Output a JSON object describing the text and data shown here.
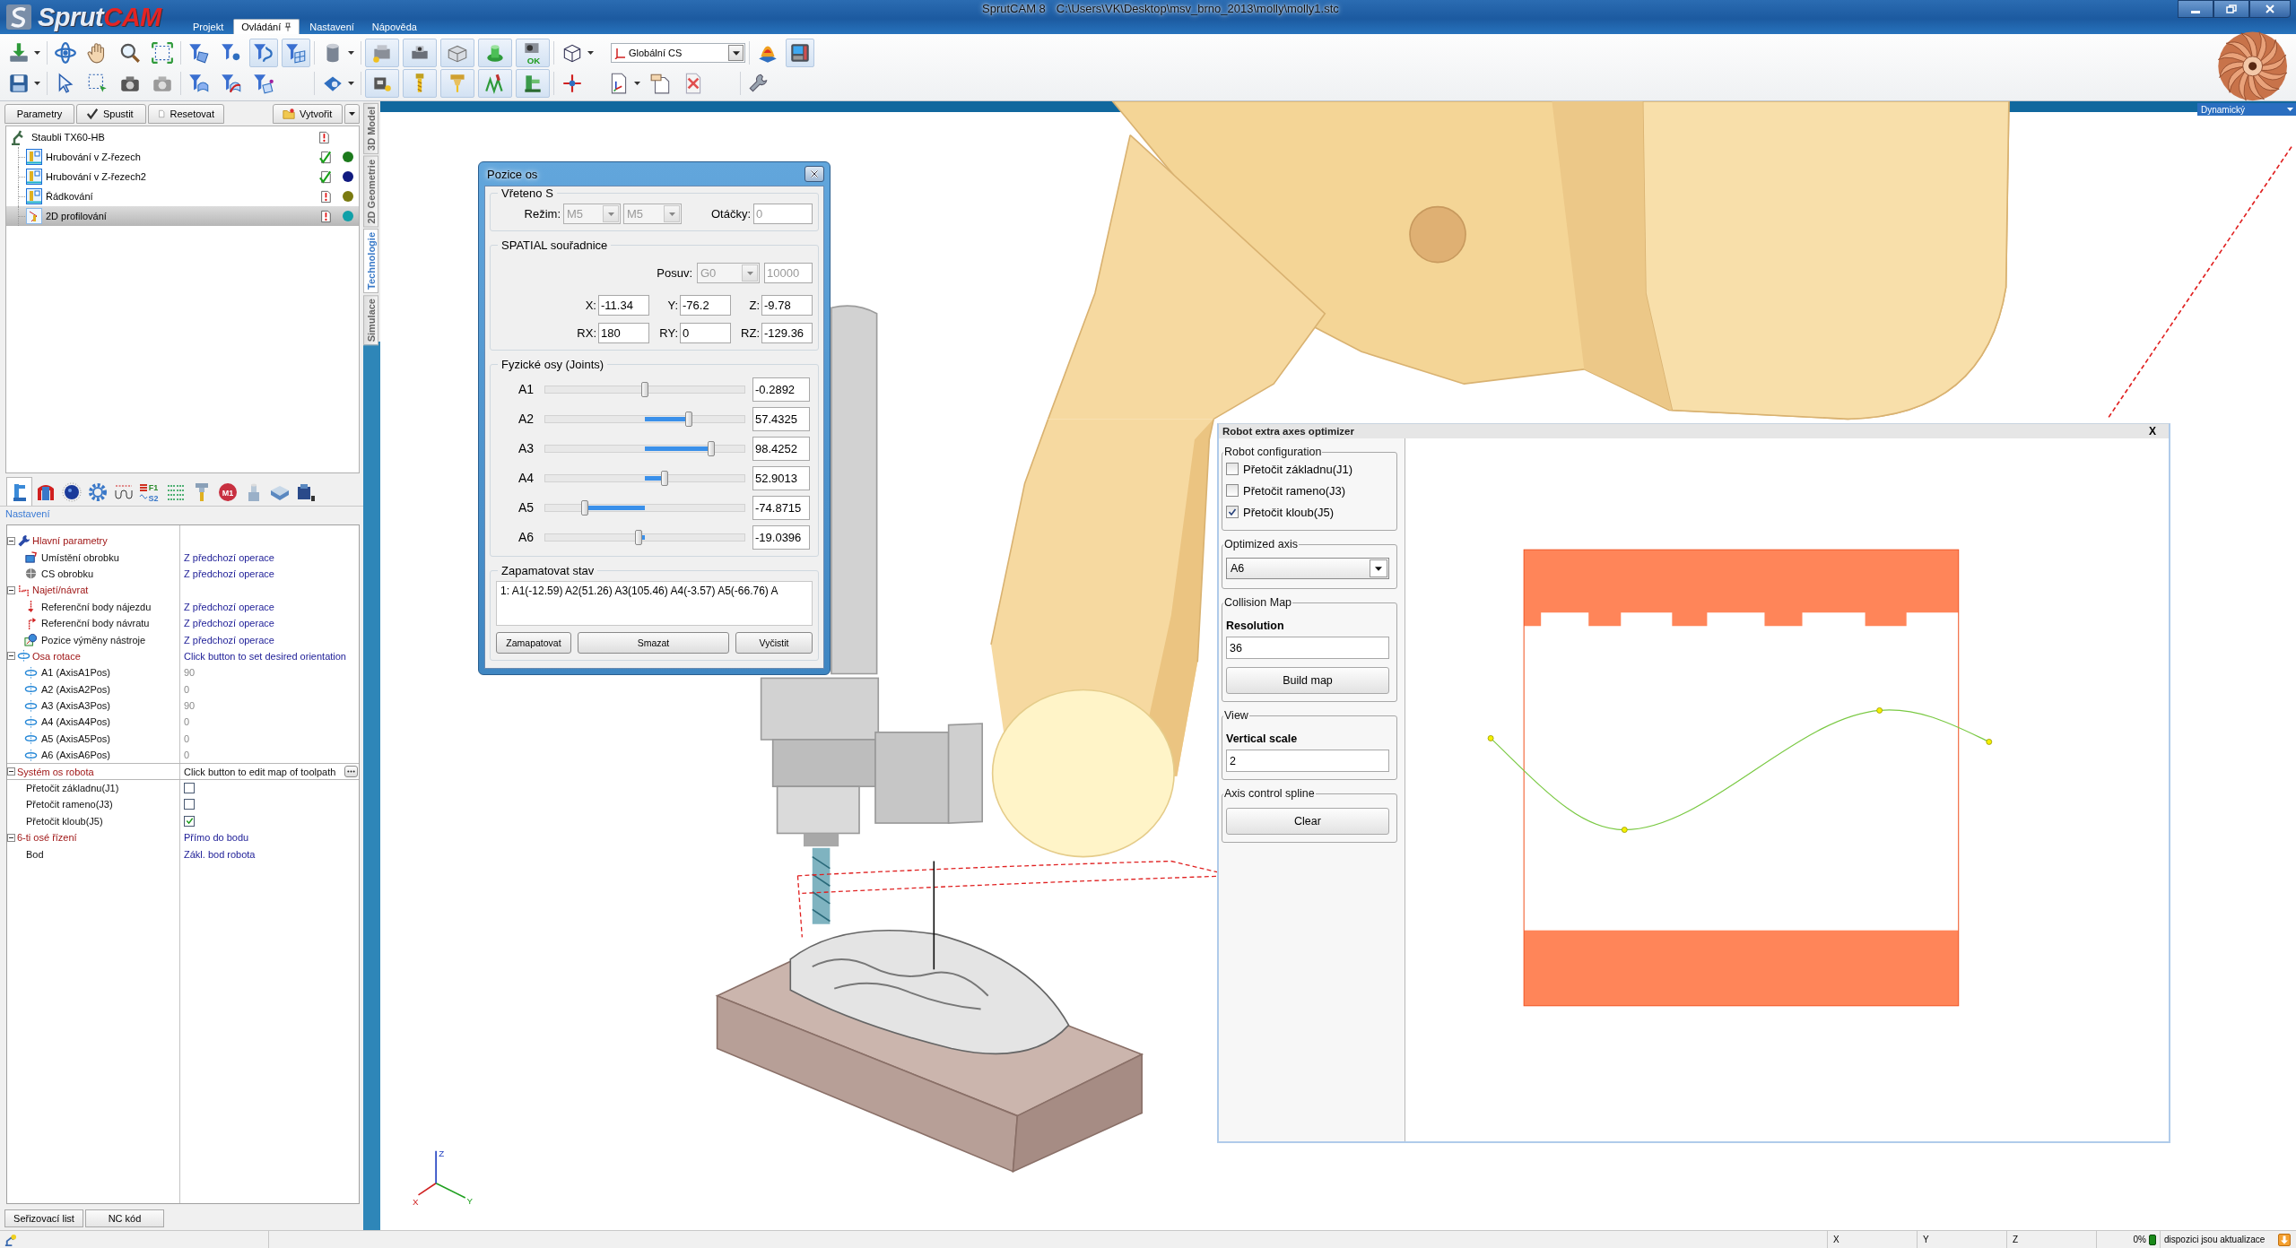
{
  "window": {
    "logo_text": "Sprut",
    "logo_accent": "CAM",
    "app_name": "SprutCAM 8",
    "file_path": "C:\\Users\\VK\\Desktop\\msv_brno_2013\\molly\\molly1.stc"
  },
  "ribbon_tabs": [
    {
      "label": "Projekt",
      "selected": false,
      "pinned": false
    },
    {
      "label": "Ovládání",
      "selected": true,
      "pinned": true
    },
    {
      "label": "Nastavení",
      "selected": false,
      "pinned": false
    },
    {
      "label": "Nápověda",
      "selected": false,
      "pinned": false
    }
  ],
  "toolbar": {
    "row_1": [
      {
        "pressed": false,
        "menu": true
      },
      {
        "pressed": false,
        "menu": false
      },
      {
        "pressed": false,
        "menu": false
      },
      {
        "pressed": false,
        "menu": false
      },
      {
        "pressed": false,
        "menu": false
      },
      {
        "pressed": false,
        "menu": false
      },
      {
        "pressed": false,
        "menu": false
      },
      {
        "pressed": true,
        "menu": false
      },
      {
        "pressed": true,
        "menu": false
      },
      {
        "pressed": false,
        "menu": true
      },
      {
        "pressed": true,
        "menu": false
      },
      {
        "pressed": true,
        "menu": false
      },
      {
        "pressed": true,
        "menu": false
      },
      {
        "pressed": true,
        "menu": false
      },
      {
        "pressed": true,
        "menu": false,
        "badge": "OK"
      },
      {
        "pressed": false,
        "menu": true
      },
      {
        "pressed": false,
        "menu": false
      },
      {
        "pressed": true,
        "menu": false
      }
    ],
    "cs_combo": "Globální CS",
    "row_2": [
      {
        "pressed": false,
        "menu": true
      },
      {
        "pressed": false,
        "menu": false
      },
      {
        "pressed": false,
        "menu": false
      },
      {
        "pressed": false,
        "menu": false
      },
      {
        "pressed": false,
        "menu": false
      },
      {
        "pressed": false,
        "menu": false
      },
      {
        "pressed": false,
        "menu": false
      },
      {
        "pressed": false,
        "menu": false
      },
      {
        "pressed": false,
        "menu": true
      },
      {
        "pressed": true,
        "menu": false
      },
      {
        "pressed": true,
        "menu": false
      },
      {
        "pressed": true,
        "menu": false
      },
      {
        "pressed": true,
        "menu": false
      },
      {
        "pressed": true,
        "menu": false
      },
      {
        "pressed": false,
        "menu": false
      },
      {
        "pressed": false,
        "menu": true
      },
      {
        "pressed": false,
        "menu": false
      },
      {
        "pressed": false,
        "menu": false
      },
      {
        "pressed": false,
        "menu": false
      }
    ]
  },
  "view_mode": "Dynamický",
  "left_panel": {
    "actions": [
      "Parametry",
      "Spustit",
      "Resetovat",
      "Vytvořit"
    ],
    "tree": {
      "label": "Staubli TX60-HB",
      "calculated": false,
      "selected": false,
      "children": [
        {
          "label": "Hrubování v Z-řezech",
          "calculated": true,
          "color": "#1c7a1c",
          "selected": false
        },
        {
          "label": "Hrubování v Z-řezech2",
          "calculated": true,
          "color": "#101a80",
          "selected": false
        },
        {
          "label": "Řádkování",
          "calculated": false,
          "color": "#7a7a10",
          "selected": false
        },
        {
          "label": "2D profilování",
          "calculated": false,
          "color": "#10a0a8",
          "selected": true
        }
      ]
    },
    "icon_tabs": [
      {
        "selected": true
      },
      {
        "selected": false
      },
      {
        "selected": false
      },
      {
        "selected": false
      },
      {
        "selected": false
      },
      {
        "selected": false,
        "labels": [
          "F1",
          "S2"
        ]
      },
      {
        "selected": false
      },
      {
        "selected": false
      },
      {
        "selected": false,
        "labels": [
          "M1"
        ]
      },
      {
        "selected": false
      },
      {
        "selected": false
      },
      {
        "selected": false
      }
    ],
    "section_title": "Nastavení",
    "properties": [
      {
        "kind": "group",
        "label": "Hlavní parametry",
        "expanded": true,
        "editor": false,
        "children": [
          {
            "kind": "option",
            "label": "Umístění obrobku",
            "value": "Z předchozí operace"
          },
          {
            "kind": "option",
            "label": "CS obrobku",
            "value": "Z předchozí operace"
          }
        ]
      },
      {
        "kind": "group",
        "label": "Najetí/návrat",
        "expanded": true,
        "editor": false,
        "children": [
          {
            "kind": "option",
            "label": "Referenční body nájezdu",
            "value": "Z předchozí operace"
          },
          {
            "kind": "option",
            "label": "Referenční body návratu",
            "value": "Z předchozí operace"
          },
          {
            "kind": "option",
            "label": "Pozice výměny nástroje",
            "value": "Z předchozí operace"
          }
        ]
      },
      {
        "kind": "group",
        "label": "Osa rotace",
        "value": "Click button to set desired orientation",
        "expanded": true,
        "editor": false,
        "children": [
          {
            "kind": "axis",
            "label": "A1 (AxisA1Pos)",
            "value": "90"
          },
          {
            "kind": "axis",
            "label": "A2 (AxisA2Pos)",
            "value": "0"
          },
          {
            "kind": "axis",
            "label": "A3 (AxisA3Pos)",
            "value": "90"
          },
          {
            "kind": "axis",
            "label": "A4 (AxisA4Pos)",
            "value": "0"
          },
          {
            "kind": "axis",
            "label": "A5 (AxisA5Pos)",
            "value": "0"
          },
          {
            "kind": "axis",
            "label": "A6 (AxisA6Pos)",
            "value": "0"
          }
        ]
      },
      {
        "kind": "group",
        "label": "Systém os robota",
        "value": "Click button to edit map of toolpath",
        "expanded": true,
        "editor": true,
        "children": [
          {
            "kind": "check",
            "label": "Přetočit základnu(J1)",
            "checked": false
          },
          {
            "kind": "check",
            "label": "Přetočit rameno(J3)",
            "checked": false
          },
          {
            "kind": "check",
            "label": "Přetočit kloub(J5)",
            "checked": true
          }
        ]
      },
      {
        "kind": "group",
        "label": "6-ti osé řízení",
        "value": "Přímo do bodu",
        "expanded": true,
        "editor": false,
        "children": [
          {
            "kind": "option",
            "label": "Bod",
            "value": "Zákl. bod robota"
          }
        ]
      }
    ],
    "bottom_tabs": [
      {
        "label": "Seřizovací list",
        "selected": false
      },
      {
        "label": "NC kód",
        "selected": false
      }
    ]
  },
  "side_tabs": [
    {
      "label": "3D Model",
      "selected": false
    },
    {
      "label": "2D Geometrie",
      "selected": false
    },
    {
      "label": "Technologie",
      "selected": true
    },
    {
      "label": "Simulace",
      "selected": false
    }
  ],
  "viewport": {
    "axis_labels": [
      "X",
      "Y",
      "Z"
    ]
  },
  "axis_dialog": {
    "title": "Pozice os",
    "spindle": {
      "title": "Vřeteno S",
      "mode_label": "Režim:",
      "modes": [
        {
          "value": "M5",
          "disabled": true
        },
        {
          "value": "M5",
          "disabled": true
        }
      ],
      "speed_label": "Otáčky:",
      "speed": {
        "value": "0",
        "disabled": true
      }
    },
    "spatial": {
      "title": "SPATIAL souřadnice",
      "feed_label": "Posuv:",
      "feed_mode": {
        "value": "G0",
        "disabled": true
      },
      "feed": {
        "value": "10000",
        "disabled": true
      },
      "coords": [
        {
          "label": "X:",
          "value": "-11.34"
        },
        {
          "label": "Y:",
          "value": "-76.2"
        },
        {
          "label": "Z:",
          "value": "-9.78"
        },
        {
          "label": "RX:",
          "value": "180"
        },
        {
          "label": "RY:",
          "value": "0"
        },
        {
          "label": "RZ:",
          "value": "-129.36"
        }
      ]
    },
    "joints": {
      "title": "Fyzické osy (Joints)",
      "axes": [
        {
          "name": "A1",
          "level": 0.502,
          "reading": "-0.2892"
        },
        {
          "name": "A2",
          "level": 0.72,
          "reading": "57.4325"
        },
        {
          "name": "A3",
          "level": 0.835,
          "reading": "98.4252"
        },
        {
          "name": "A4",
          "level": 0.6,
          "reading": "52.9013"
        },
        {
          "name": "A5",
          "level": 0.2,
          "reading": "-74.8715"
        },
        {
          "name": "A6",
          "level": 0.467,
          "reading": "-19.0396"
        }
      ]
    },
    "memory": {
      "title": "Zapamatovat stav",
      "entries": [
        "1: A1(-12.59) A2(51.26) A3(105.46) A4(-3.57) A5(-66.76) A"
      ],
      "buttons": [
        "Zamapatovat",
        "Smazat",
        "Vyčistit"
      ]
    }
  },
  "optimizer": {
    "title": "Robot extra axes optimizer",
    "close_label": "X",
    "configuration": {
      "title": "Robot configuration",
      "options": [
        {
          "label": "Přetočit základnu(J1)",
          "checked": false
        },
        {
          "label": "Přetočit rameno(J3)",
          "checked": false
        },
        {
          "label": "Přetočit kloub(J5)",
          "checked": true
        }
      ]
    },
    "optimized_axis": {
      "title": "Optimized axis",
      "value": "A6"
    },
    "collision_map": {
      "title": "Collision Map",
      "resolution_label": "Resolution",
      "resolution": "36",
      "button": "Build map"
    },
    "view": {
      "title": "View",
      "scale_label": "Vertical scale",
      "scale": "2"
    },
    "spline": {
      "title": "Axis control spline",
      "button": "Clear"
    }
  },
  "status_bar": {
    "coords": [
      "X",
      "Y",
      "Z"
    ],
    "progress": "0%",
    "message": "dispozici jsou aktualizace"
  }
}
